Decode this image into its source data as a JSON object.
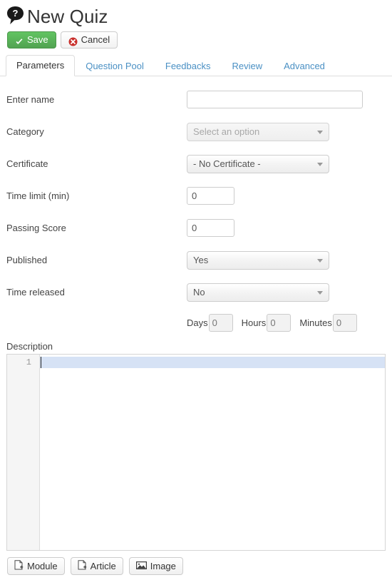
{
  "header": {
    "icon": "quiz-question-bubble-icon",
    "title": "New Quiz"
  },
  "toolbar": {
    "save_label": "Save",
    "save_icon": "check-icon",
    "save_color": "#51a351",
    "cancel_label": "Cancel",
    "cancel_icon": "circle-x-icon",
    "cancel_icon_color": "#c9302c"
  },
  "tabs": [
    {
      "label": "Parameters",
      "active": true
    },
    {
      "label": "Question Pool",
      "active": false
    },
    {
      "label": "Feedbacks",
      "active": false
    },
    {
      "label": "Review",
      "active": false
    },
    {
      "label": "Advanced",
      "active": false
    }
  ],
  "tab_link_color": "#4a90c4",
  "form": {
    "name": {
      "label": "Enter name",
      "value": "",
      "placeholder": ""
    },
    "category": {
      "label": "Category",
      "value": "Select an option",
      "disabled": true
    },
    "certificate": {
      "label": "Certificate",
      "value": "- No Certificate -",
      "disabled": false
    },
    "time_limit": {
      "label": "Time limit (min)",
      "value": "0"
    },
    "passing_score": {
      "label": "Passing Score",
      "value": "0"
    },
    "published": {
      "label": "Published",
      "value": "Yes"
    },
    "time_released": {
      "label": "Time released",
      "value": "No"
    },
    "days": {
      "label": "Days",
      "value": "0"
    },
    "hours": {
      "label": "Hours",
      "value": "0"
    },
    "minutes": {
      "label": "Minutes",
      "value": "0"
    }
  },
  "description": {
    "label": "Description",
    "line_number": "1",
    "content": "",
    "active_line_color": "#d6e2f5"
  },
  "bottom_buttons": [
    {
      "label": "Module",
      "icon": "file-plus-icon"
    },
    {
      "label": "Article",
      "icon": "file-plus-icon"
    },
    {
      "label": "Image",
      "icon": "picture-icon"
    }
  ]
}
